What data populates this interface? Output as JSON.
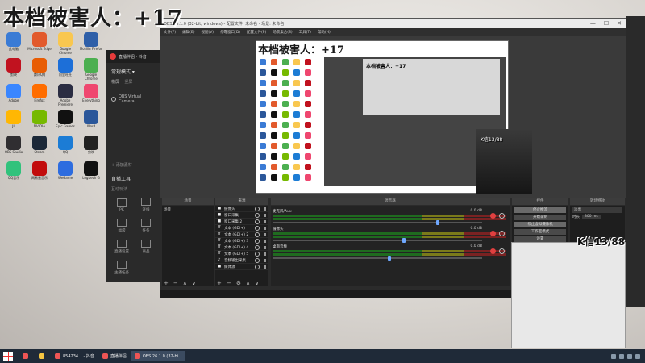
{
  "overlay": {
    "title": "本档被害人：+17",
    "k_badge": "K信13/88",
    "cam_text": "K信13/88"
  },
  "desktop": {
    "icons": [
      {
        "label": "此电脑",
        "color": "#3a7bd5"
      },
      {
        "label": "Microsoft Edge",
        "color": "#e25a2c"
      },
      {
        "label": "Google Chrome",
        "color": "#f9c74f"
      },
      {
        "label": "Mozilla Firefox",
        "color": "#2f5fa8"
      },
      {
        "label": "剪映",
        "color": "#c1121f"
      },
      {
        "label": "腾讯QQ",
        "color": "#e85d04"
      },
      {
        "label": "阿里旺旺",
        "color": "#1d6fd8"
      },
      {
        "label": "Google Chrome",
        "color": "#4caf50"
      },
      {
        "label": "Adobe",
        "color": "#3a86ff"
      },
      {
        "label": "Firefox",
        "color": "#ff6d00"
      },
      {
        "label": "Adobe Premiere",
        "color": "#2b2d42"
      },
      {
        "label": "Everything",
        "color": "#ef476f"
      },
      {
        "label": "JL",
        "color": "#ffb703"
      },
      {
        "label": "NVIDIA",
        "color": "#76b900"
      },
      {
        "label": "Epic Games",
        "color": "#111"
      },
      {
        "label": "Word",
        "color": "#2b579a"
      },
      {
        "label": "OBS Studio",
        "color": "#302e31"
      },
      {
        "label": "Steam",
        "color": "#1b2838"
      },
      {
        "label": "QQ",
        "color": "#1c7cd5"
      },
      {
        "label": "剪映",
        "color": "#222"
      },
      {
        "label": "QQ音乐",
        "color": "#31c27c"
      },
      {
        "label": "网易云音乐",
        "color": "#c20c0c"
      },
      {
        "label": "WeGame",
        "color": "#2d6cdf"
      },
      {
        "label": "Logitech G",
        "color": "#111"
      }
    ]
  },
  "live_app": {
    "title": "直播伴侣 · 抖音",
    "mode": "常规模式 ▾",
    "tabs": [
      "横屏",
      "竖屏"
    ],
    "source_item": "OBS Virtual Camera",
    "add_material": "+ 添加素材",
    "tools_header": "直播工具",
    "tools_sub": "互动玩法",
    "tiles": [
      {
        "label": "PK"
      },
      {
        "label": "连线"
      },
      {
        "label": "福袋"
      },
      {
        "label": "任务"
      },
      {
        "label": "直播设置"
      },
      {
        "label": "商品"
      },
      {
        "label": "主播任务"
      }
    ],
    "tools_sub2": "基础功能"
  },
  "obs": {
    "title": "OBS 26.1.0 (32-bit, windows) - 配置文件: 未命名 - 场景: 未命名",
    "menu": [
      "文件(F)",
      "编辑(E)",
      "视图(V)",
      "停靠窗口(D)",
      "配置文件(P)",
      "场景集合(S)",
      "工具(T)",
      "帮助(H)"
    ],
    "window_controls": [
      "—",
      "☐",
      "✕"
    ],
    "preview_title": "本档被害人：+17",
    "preview_inner_title": "本档被害人：+17",
    "dock_headers": {
      "scenes": "场景",
      "sources": "来源",
      "mixer": "混音器",
      "controls": "控件",
      "transitions": "转场特效"
    },
    "no_source_selected": "未选择源",
    "scenes": [
      "场景"
    ],
    "sources": [
      {
        "icon": "■",
        "label": "摄像头"
      },
      {
        "icon": "■",
        "label": "窗口采集"
      },
      {
        "icon": "■",
        "label": "窗口采集 2"
      },
      {
        "icon": "T",
        "label": "文本 (GDI+)"
      },
      {
        "icon": "T",
        "label": "文本 (GDI+) 2"
      },
      {
        "icon": "T",
        "label": "文本 (GDI+) 3"
      },
      {
        "icon": "T",
        "label": "文本 (GDI+) 4"
      },
      {
        "icon": "T",
        "label": "文本 (GDI+) 5"
      },
      {
        "icon": "♪",
        "label": "音频输出采集"
      },
      {
        "icon": "■",
        "label": "媒体源"
      }
    ],
    "mixer_tracks": [
      {
        "name": "麦克风/Aux",
        "db": "0.0 dB",
        "fader": 0.78
      },
      {
        "name": "摄像头",
        "db": "0.0 dB",
        "fader": 0.62
      },
      {
        "name": "桌面音频",
        "db": "0.0 dB",
        "fader": 0.55
      }
    ],
    "controls": [
      {
        "label": "停止推流",
        "on": true
      },
      {
        "label": "开始录制",
        "on": false
      },
      {
        "label": "停止虚拟摄像机",
        "on": true
      },
      {
        "label": "工作室模式",
        "on": false
      },
      {
        "label": "设置",
        "on": false
      },
      {
        "label": "退出",
        "on": false
      }
    ],
    "transitions": {
      "type": "淡出",
      "duration_label": "时长",
      "duration": "300 ms"
    }
  },
  "taskbar": {
    "items": [
      {
        "label": "",
        "kind": "search"
      },
      {
        "label": "",
        "kind": "folder"
      },
      {
        "label": "854234... - 抖音",
        "kind": "app"
      },
      {
        "label": "直播伴侣",
        "kind": "app"
      },
      {
        "label": "OBS 26.1.0 (32-bi...",
        "kind": "app",
        "active": true
      }
    ]
  }
}
